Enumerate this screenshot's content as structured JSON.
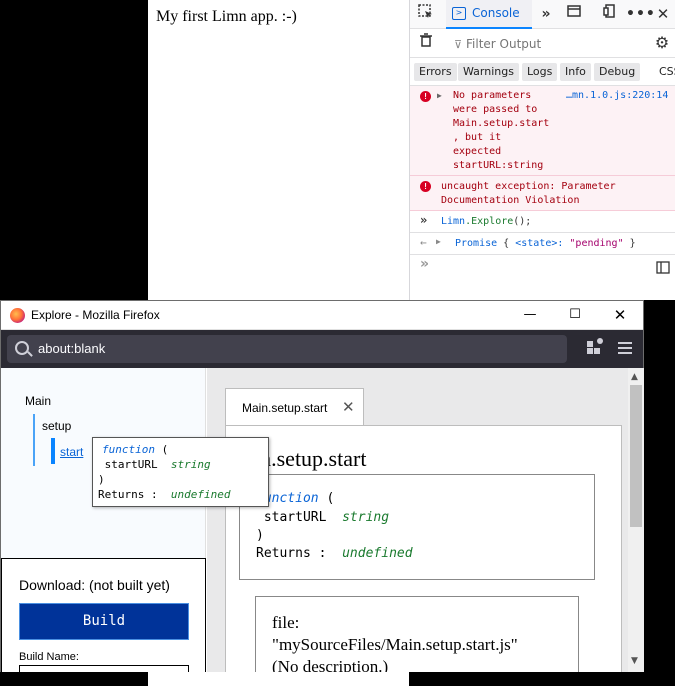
{
  "app": {
    "text": "My first Limn app. :-)"
  },
  "devtools": {
    "console_tab": "Console",
    "filter_placeholder": "Filter Output",
    "levels": [
      "Errors",
      "Warnings",
      "Logs",
      "Info",
      "Debug",
      "CSS"
    ],
    "messages": {
      "error1_lines": [
        "No parameters",
        "were passed to",
        "Main.setup.start",
        ", but it",
        "expected",
        "startURL:string"
      ],
      "error1_source": "…mn.1.0.js:220:14",
      "error2_lines": [
        "uncaught exception: Parameter",
        "Documentation Violation"
      ],
      "input_prefix": "Limn",
      "input_method": ".Explore",
      "input_suffix": "();",
      "result_word": "Promise",
      "result_open": " { ",
      "result_state": "<state>:",
      "result_value": " \"pending\"",
      "result_close": " }"
    }
  },
  "firefox": {
    "title": "Explore - Mozilla Firefox",
    "url": "about:blank"
  },
  "tree": {
    "root": "Main",
    "child": "setup",
    "leaf": "start"
  },
  "download": {
    "label": "Download: (not built yet)",
    "build_button": "Build",
    "build_name_label": "Build Name:"
  },
  "doc": {
    "tab_label": "Main.setup.start",
    "title": "Main.setup.start",
    "title_shown": "in.setup.start",
    "sig_keyword": "function",
    "sig_open": " (",
    "sig_param": " startURL",
    "sig_param_type": "string",
    "sig_close": ")",
    "sig_returns": "Returns :",
    "sig_return_type": "undefined",
    "file_lines": [
      "file:",
      "\"mySourceFiles/Main.setup.start.js\"",
      "(No description.)"
    ]
  },
  "tooltip": {
    "keyword": "function",
    "open": " (",
    "param": " startURL",
    "param_type": "string",
    "close": ")",
    "returns": "Returns :",
    "return_type": "undefined"
  },
  "colors": {
    "accent": "#0a84ff",
    "build_button_bg": "#003399",
    "error_text": "#a4000f",
    "urlbar_bg": "#2b2a33"
  },
  "icons": [
    "inspector-icon",
    "console-icon",
    "overflow-chevrons-icon",
    "responsive-icon",
    "dock-icon",
    "more-icon",
    "close-icon",
    "trash-icon",
    "filter-icon",
    "gear-icon",
    "error-icon",
    "expand-triangle-icon",
    "prompt-chevrons-icon",
    "result-arrow-icon",
    "sidebar-icon",
    "firefox-logo-icon",
    "minimize-icon",
    "maximize-icon",
    "search-icon",
    "extensions-icon",
    "menu-icon",
    "tab-close-icon",
    "scroll-up-icon",
    "scroll-down-icon"
  ]
}
